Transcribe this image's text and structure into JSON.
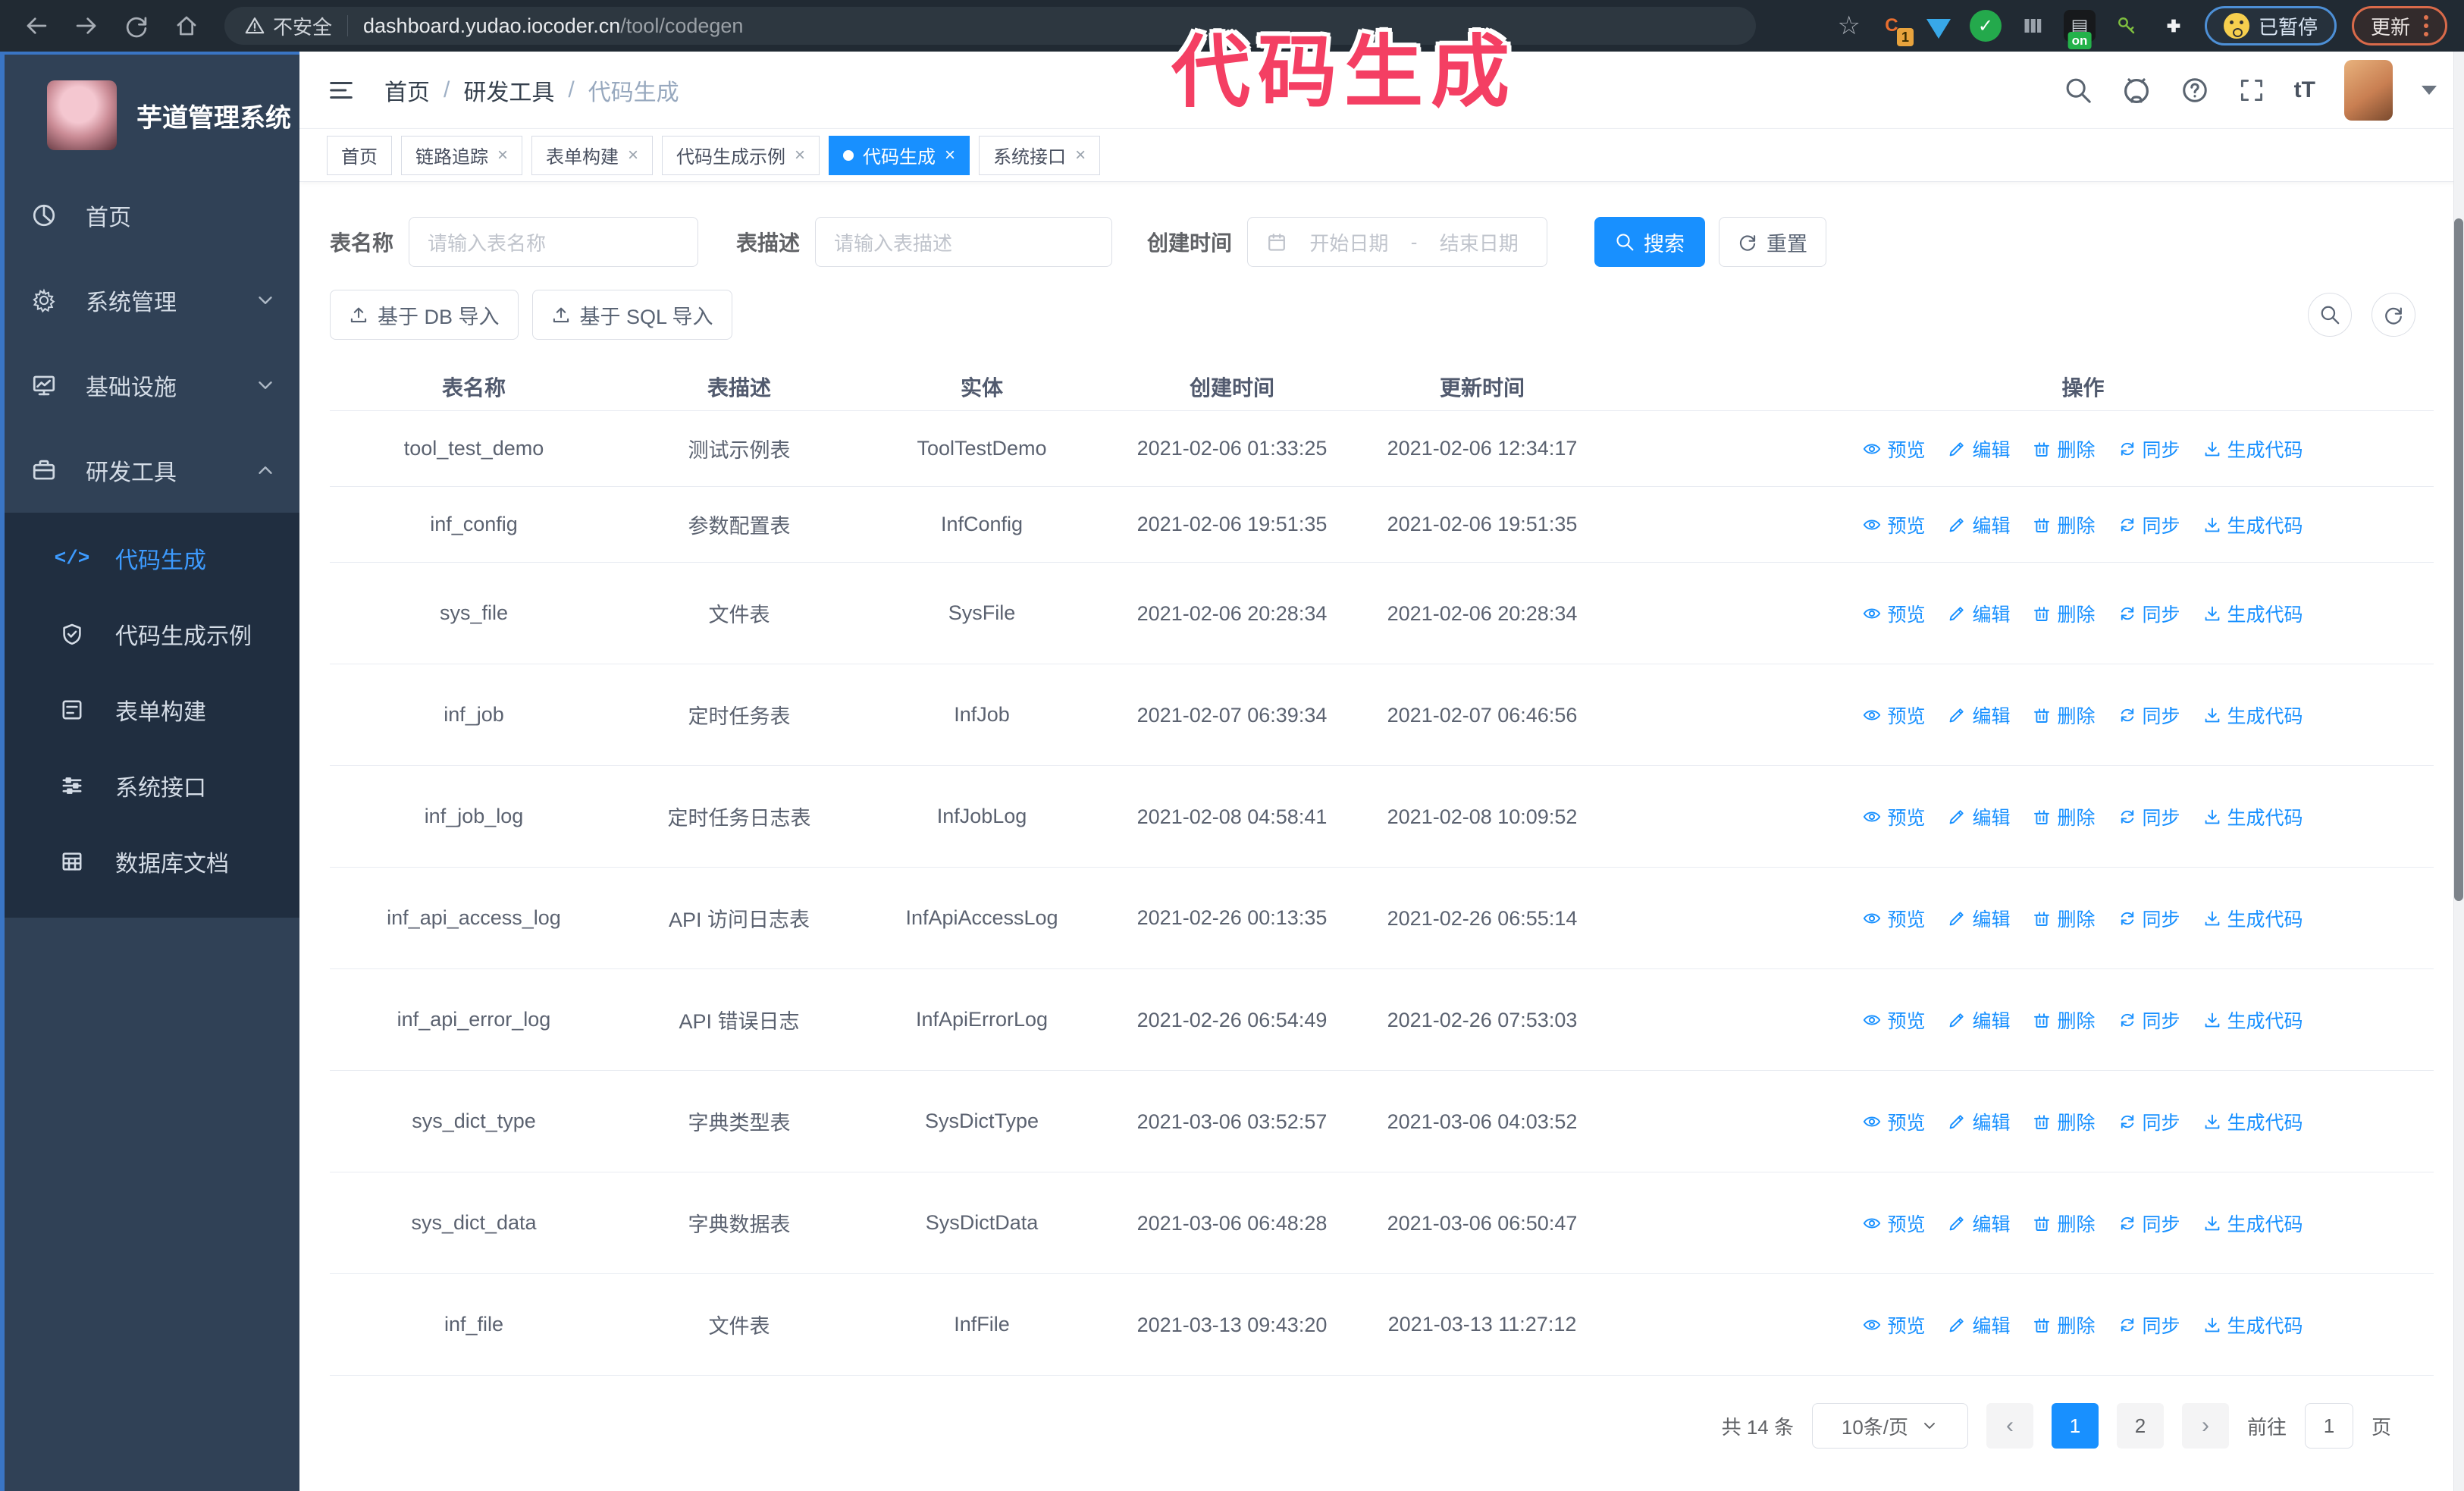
{
  "browser": {
    "security_label": "不安全",
    "url_host": "dashboard.yudao.iocoder.cn",
    "url_path": "/tool/codegen",
    "extension_badge": "1",
    "extension_on_badge": "on",
    "paused_badge": "已暂停",
    "update_button": "更新"
  },
  "overlay": {
    "title": "代码生成",
    "color": "#f43f63"
  },
  "sidebar": {
    "app_title": "芋道管理系统",
    "items": [
      {
        "label": "首页"
      },
      {
        "label": "系统管理"
      },
      {
        "label": "基础设施"
      },
      {
        "label": "研发工具"
      }
    ],
    "subitems": [
      {
        "label": "代码生成"
      },
      {
        "label": "代码生成示例"
      },
      {
        "label": "表单构建"
      },
      {
        "label": "系统接口"
      },
      {
        "label": "数据库文档"
      }
    ],
    "active_color": "#3d9bff"
  },
  "header": {
    "breadcrumb": {
      "home": "首页",
      "group": "研发工具",
      "current": "代码生成"
    }
  },
  "tabs": [
    {
      "label": "首页"
    },
    {
      "label": "链路追踪"
    },
    {
      "label": "表单构建"
    },
    {
      "label": "代码生成示例"
    },
    {
      "label": "代码生成"
    },
    {
      "label": "系统接口"
    }
  ],
  "filters": {
    "table_name_label": "表名称",
    "table_name_placeholder": "请输入表名称",
    "table_desc_label": "表描述",
    "table_desc_placeholder": "请输入表描述",
    "create_time_label": "创建时间",
    "date_start_placeholder": "开始日期",
    "date_separator": "-",
    "date_end_placeholder": "结束日期",
    "search_label": "搜索",
    "reset_label": "重置"
  },
  "toolbar": {
    "import_db_label": "基于 DB 导入",
    "import_sql_label": "基于 SQL 导入"
  },
  "table": {
    "columns": {
      "name": "表名称",
      "desc": "表描述",
      "entity": "实体",
      "created": "创建时间",
      "updated": "更新时间",
      "ops": "操作"
    },
    "actions": {
      "preview": "预览",
      "edit": "编辑",
      "del": "删除",
      "sync": "同步",
      "gen": "生成代码"
    },
    "rows": [
      {
        "name": "tool_test_demo",
        "desc": "测试示例表",
        "entity": "ToolTestDemo",
        "created": "2021-02-06 01:33:25",
        "updated": "2021-02-06 12:34:17"
      },
      {
        "name": "inf_config",
        "desc": "参数配置表",
        "entity": "InfConfig",
        "created": "2021-02-06 19:51:35",
        "updated": "2021-02-06 19:51:35"
      },
      {
        "name": "sys_file",
        "desc": "文件表",
        "entity": "SysFile",
        "created": "2021-02-06 20:28:34",
        "updated": "2021-02-06 20:28:34"
      },
      {
        "name": "inf_job",
        "desc": "定时任务表",
        "entity": "InfJob",
        "created": "2021-02-07 06:39:34",
        "updated": "2021-02-07 06:46:56"
      },
      {
        "name": "inf_job_log",
        "desc": "定时任务日志表",
        "entity": "InfJobLog",
        "created": "2021-02-08 04:58:41",
        "updated": "2021-02-08 10:09:52"
      },
      {
        "name": "inf_api_access_log",
        "desc": "API 访问日志表",
        "entity": "InfApiAccessLog",
        "created": "2021-02-26 00:13:35",
        "updated": "2021-02-26 06:55:14"
      },
      {
        "name": "inf_api_error_log",
        "desc": "API 错误日志",
        "entity": "InfApiErrorLog",
        "created": "2021-02-26 06:54:49",
        "updated": "2021-02-26 07:53:03"
      },
      {
        "name": "sys_dict_type",
        "desc": "字典类型表",
        "entity": "SysDictType",
        "created": "2021-03-06 03:52:57",
        "updated": "2021-03-06 04:03:52"
      },
      {
        "name": "sys_dict_data",
        "desc": "字典数据表",
        "entity": "SysDictData",
        "created": "2021-03-06 06:48:28",
        "updated": "2021-03-06 06:50:47"
      },
      {
        "name": "inf_file",
        "desc": "文件表",
        "entity": "InfFile",
        "created": "2021-03-13 09:43:20",
        "updated": "2021-03-13 11:27:12"
      }
    ]
  },
  "pagination": {
    "total_label": "共 14 条",
    "page_size": "10条/页",
    "prev": "‹",
    "page1": "1",
    "page2": "2",
    "next": "›",
    "goto_label": "前往",
    "goto_value": "1",
    "page_suffix": "页"
  }
}
